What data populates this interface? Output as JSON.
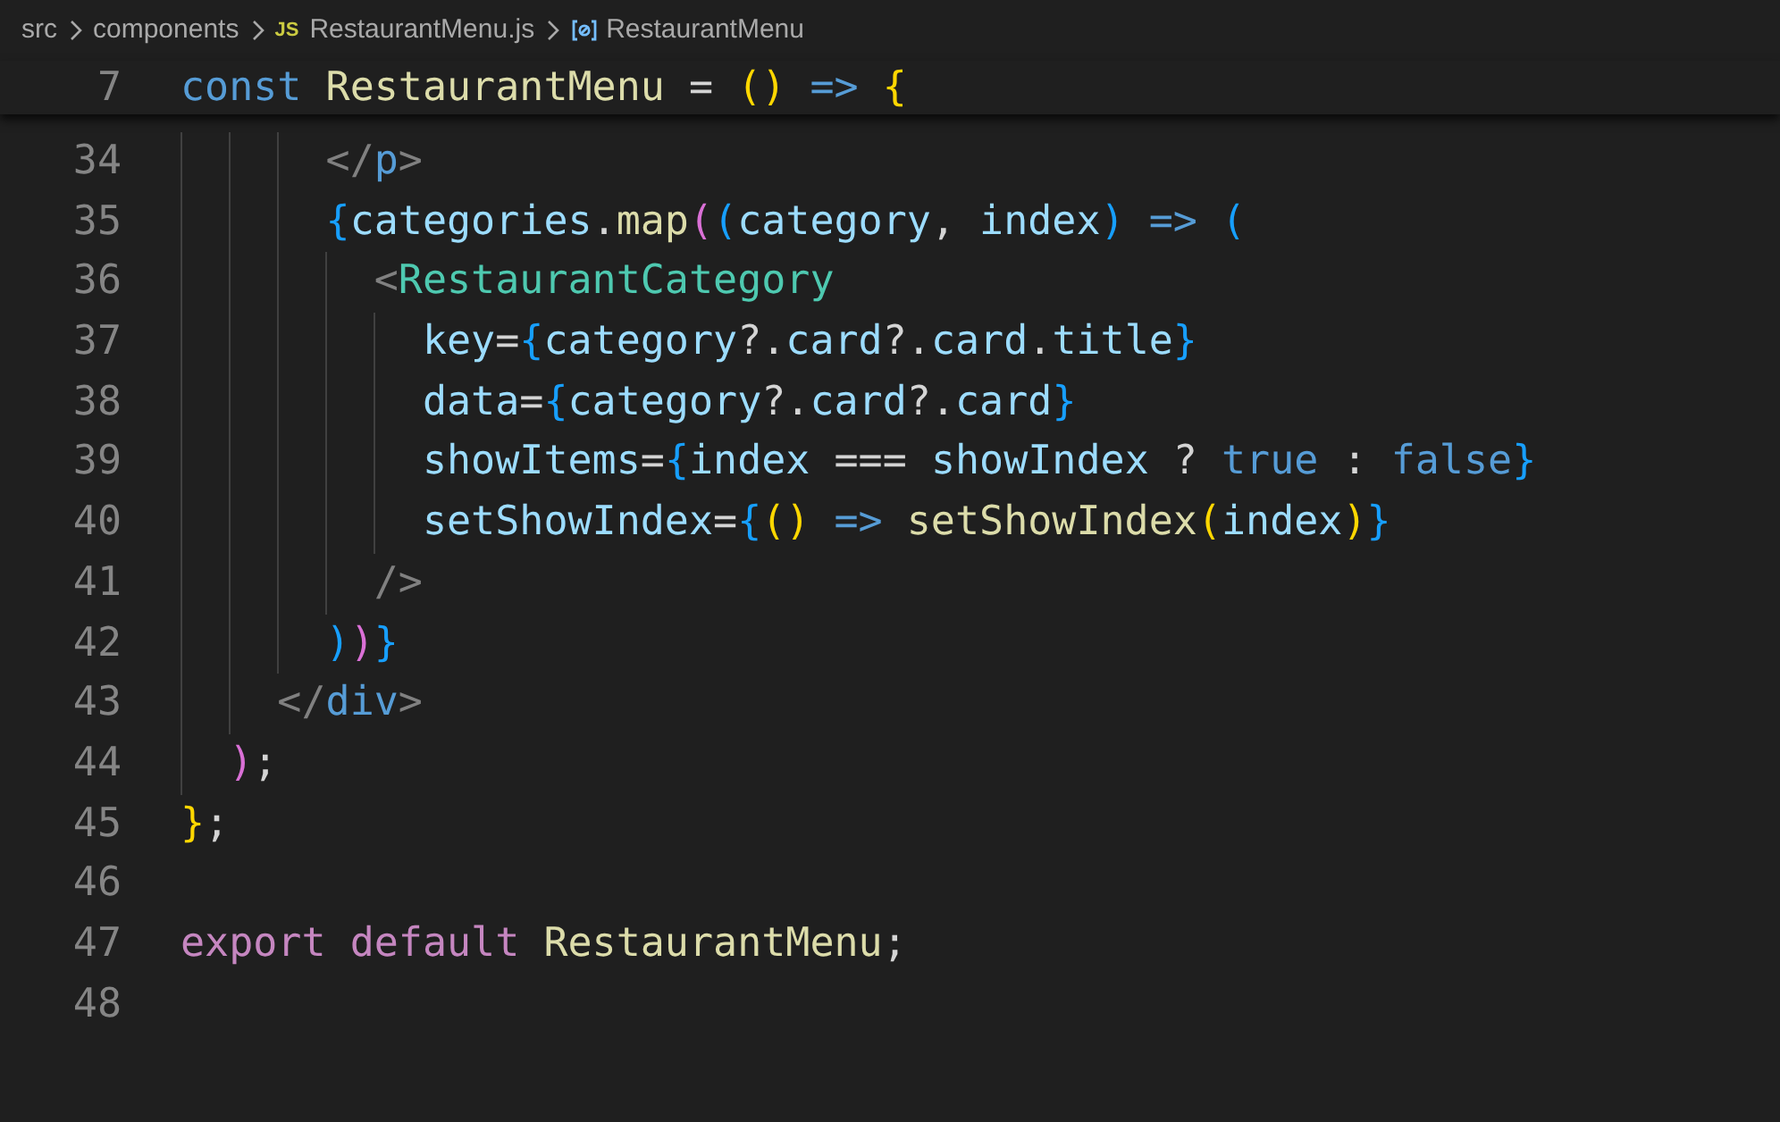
{
  "breadcrumb": [
    {
      "kind": "folder",
      "label": "src"
    },
    {
      "kind": "folder",
      "label": "components"
    },
    {
      "kind": "file",
      "badge": "JS",
      "label": "RestaurantMenu.js"
    },
    {
      "kind": "symbol",
      "label": "RestaurantMenu"
    }
  ],
  "sticky_line": {
    "number": "7",
    "tokens": [
      {
        "text": "const",
        "color": "#569cd6"
      },
      {
        "text": " RestaurantMenu",
        "color": "#dcdcaa"
      },
      {
        "text": " =",
        "color": "#d4d4d4"
      },
      {
        "text": " ()",
        "color": "#ffd700"
      },
      {
        "text": " =>",
        "color": "#569cd6"
      },
      {
        "text": " {",
        "color": "#ffd700"
      }
    ]
  },
  "lines": [
    {
      "number": "34",
      "tokens": [
        {
          "text": "      </",
          "color": "#808080"
        },
        {
          "text": "p",
          "color": "#569cd6"
        },
        {
          "text": ">",
          "color": "#808080"
        }
      ]
    },
    {
      "number": "35",
      "tokens": [
        {
          "text": "      {",
          "color": "#179fff"
        },
        {
          "text": "categories",
          "color": "#9cdcfe"
        },
        {
          "text": ".",
          "color": "#d4d4d4"
        },
        {
          "text": "map",
          "color": "#dcdcaa"
        },
        {
          "text": "(",
          "color": "#da70d6"
        },
        {
          "text": "(",
          "color": "#179fff"
        },
        {
          "text": "category",
          "color": "#9cdcfe"
        },
        {
          "text": ",",
          "color": "#d4d4d4"
        },
        {
          "text": " index",
          "color": "#9cdcfe"
        },
        {
          "text": ")",
          "color": "#179fff"
        },
        {
          "text": " =>",
          "color": "#569cd6"
        },
        {
          "text": " (",
          "color": "#179fff"
        }
      ]
    },
    {
      "number": "36",
      "tokens": [
        {
          "text": "        <",
          "color": "#808080"
        },
        {
          "text": "RestaurantCategory",
          "color": "#4ec9b0"
        }
      ]
    },
    {
      "number": "37",
      "tokens": [
        {
          "text": "          key",
          "color": "#9cdcfe"
        },
        {
          "text": "=",
          "color": "#d4d4d4"
        },
        {
          "text": "{",
          "color": "#179fff"
        },
        {
          "text": "category",
          "color": "#9cdcfe"
        },
        {
          "text": "?.",
          "color": "#d4d4d4"
        },
        {
          "text": "card",
          "color": "#9cdcfe"
        },
        {
          "text": "?.",
          "color": "#d4d4d4"
        },
        {
          "text": "card",
          "color": "#9cdcfe"
        },
        {
          "text": ".",
          "color": "#d4d4d4"
        },
        {
          "text": "title",
          "color": "#9cdcfe"
        },
        {
          "text": "}",
          "color": "#179fff"
        }
      ]
    },
    {
      "number": "38",
      "tokens": [
        {
          "text": "          data",
          "color": "#9cdcfe"
        },
        {
          "text": "=",
          "color": "#d4d4d4"
        },
        {
          "text": "{",
          "color": "#179fff"
        },
        {
          "text": "category",
          "color": "#9cdcfe"
        },
        {
          "text": "?.",
          "color": "#d4d4d4"
        },
        {
          "text": "card",
          "color": "#9cdcfe"
        },
        {
          "text": "?.",
          "color": "#d4d4d4"
        },
        {
          "text": "card",
          "color": "#9cdcfe"
        },
        {
          "text": "}",
          "color": "#179fff"
        }
      ]
    },
    {
      "number": "39",
      "tokens": [
        {
          "text": "          showItems",
          "color": "#9cdcfe"
        },
        {
          "text": "=",
          "color": "#d4d4d4"
        },
        {
          "text": "{",
          "color": "#179fff"
        },
        {
          "text": "index",
          "color": "#9cdcfe"
        },
        {
          "text": " ===",
          "color": "#d4d4d4"
        },
        {
          "text": " showIndex",
          "color": "#9cdcfe"
        },
        {
          "text": " ?",
          "color": "#d4d4d4"
        },
        {
          "text": " true",
          "color": "#569cd6"
        },
        {
          "text": " :",
          "color": "#d4d4d4"
        },
        {
          "text": " false",
          "color": "#569cd6"
        },
        {
          "text": "}",
          "color": "#179fff"
        }
      ]
    },
    {
      "number": "40",
      "tokens": [
        {
          "text": "          setShowIndex",
          "color": "#9cdcfe"
        },
        {
          "text": "=",
          "color": "#d4d4d4"
        },
        {
          "text": "{",
          "color": "#179fff"
        },
        {
          "text": "()",
          "color": "#ffd700"
        },
        {
          "text": " =>",
          "color": "#569cd6"
        },
        {
          "text": " setShowIndex",
          "color": "#dcdcaa"
        },
        {
          "text": "(",
          "color": "#ffd700"
        },
        {
          "text": "index",
          "color": "#9cdcfe"
        },
        {
          "text": ")",
          "color": "#ffd700"
        },
        {
          "text": "}",
          "color": "#179fff"
        }
      ]
    },
    {
      "number": "41",
      "tokens": [
        {
          "text": "        />",
          "color": "#808080"
        }
      ]
    },
    {
      "number": "42",
      "tokens": [
        {
          "text": "      )",
          "color": "#179fff"
        },
        {
          "text": ")",
          "color": "#da70d6"
        },
        {
          "text": "}",
          "color": "#179fff"
        }
      ]
    },
    {
      "number": "43",
      "tokens": [
        {
          "text": "    </",
          "color": "#808080"
        },
        {
          "text": "div",
          "color": "#569cd6"
        },
        {
          "text": ">",
          "color": "#808080"
        }
      ]
    },
    {
      "number": "44",
      "tokens": [
        {
          "text": "  )",
          "color": "#da70d6"
        },
        {
          "text": ";",
          "color": "#d4d4d4"
        }
      ]
    },
    {
      "number": "45",
      "tokens": [
        {
          "text": "}",
          "color": "#ffd700"
        },
        {
          "text": ";",
          "color": "#d4d4d4"
        }
      ]
    },
    {
      "number": "46"
    },
    {
      "number": "47",
      "tokens": [
        {
          "text": "export",
          "color": "#c586c0"
        },
        {
          "text": " default",
          "color": "#c586c0"
        },
        {
          "text": " RestaurantMenu",
          "color": "#dcdcaa"
        },
        {
          "text": ";",
          "color": "#d4d4d4"
        }
      ]
    },
    {
      "number": "48"
    }
  ]
}
